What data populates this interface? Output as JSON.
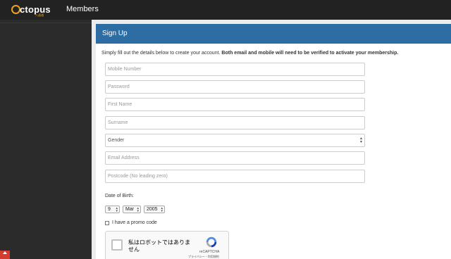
{
  "header": {
    "logo_text": "ctopus",
    "logo_sub": "八達通",
    "nav_members": "Members"
  },
  "panel": {
    "title": "Sign Up",
    "intro_plain": "Simply fill out the details below to create your account. ",
    "intro_bold": "Both email and mobile will need to be verified to activate your membership."
  },
  "form": {
    "mobile_placeholder": "Mobile Number",
    "password_placeholder": "Password",
    "first_name_placeholder": "First Name",
    "surname_placeholder": "Surname",
    "gender_selected": "Gender",
    "email_placeholder": "Email Address",
    "postcode_placeholder": "Postcode (No leading zero)",
    "dob_label": "Date of Birth:",
    "dob_day": "9",
    "dob_month": "Mar",
    "dob_year": "2005",
    "promo_label": "I have a promo code"
  },
  "captcha": {
    "text": "私はロボットではありません",
    "brand": "reCAPTCHA",
    "links": "プライバシー・利用規約"
  },
  "colors": {
    "panel_header": "#2e6da4",
    "topbar": "#222222",
    "logo_accent": "#f0a020"
  }
}
